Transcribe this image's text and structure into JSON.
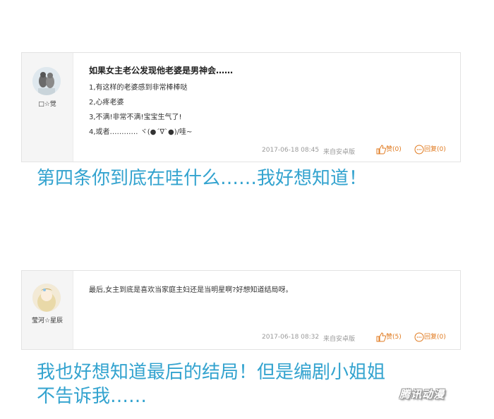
{
  "comments": [
    {
      "username": "□☆觉",
      "title": "如果女主老公发现他老婆是男神会……",
      "lines": [
        "1,有这样的老婆感到非常棒棒哒",
        "2,心疼老婆",
        "3,不满!非常不满!宝宝生气了!",
        "4,或者………… ヾ(●´∇`●)/哇~"
      ],
      "time": "2017-06-18  08:45",
      "source": "来自安卓版",
      "like_label": "赞",
      "like_count": "(0)",
      "reply_label": "回复",
      "reply_count": "(0)"
    },
    {
      "username": "莹河☆星辰",
      "text": "最后,女主到底是喜欢当家庭主妇还是当明星啊?好想知道结局呀。",
      "time": "2017-06-18  08:32",
      "source": "来自安卓版",
      "like_label": "赞",
      "like_count": "(5)",
      "reply_label": "回复",
      "reply_count": "(0)"
    }
  ],
  "captions": {
    "caption1": "第四条你到底在哇什么……我好想知道！",
    "caption2_line1": "我也好想知道最后的结局！但是编剧小姐姐",
    "caption2_line2": "不告诉我……"
  },
  "watermark": "腾讯动漫",
  "colors": {
    "caption": "#33a3cf",
    "action": "#e07a1f",
    "meta": "#999999"
  }
}
